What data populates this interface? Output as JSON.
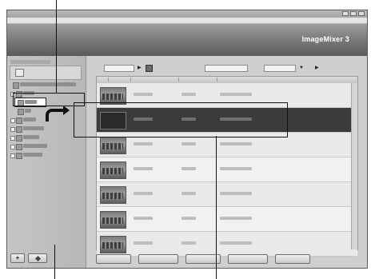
{
  "window": {
    "title": "",
    "menu": [
      "",
      "",
      "",
      "",
      "",
      ""
    ]
  },
  "header": {
    "logo": "ImageMixer 3"
  },
  "sidebar": {
    "heading": "",
    "tree": [
      {
        "label": ""
      },
      {
        "label": ""
      },
      {
        "label": ""
      },
      {
        "label": ""
      },
      {
        "label": ""
      },
      {
        "label": ""
      },
      {
        "label": ""
      },
      {
        "label": ""
      },
      {
        "label": ""
      }
    ],
    "buttons": [
      "",
      ""
    ]
  },
  "toolbar": {
    "labels": [
      "",
      "",
      "",
      ""
    ],
    "fields": [
      "",
      "",
      ""
    ]
  },
  "list": {
    "columns": [
      "",
      "",
      "",
      ""
    ],
    "rows": [
      {
        "c1": "",
        "c2": "",
        "c3": ""
      },
      {
        "c1": "",
        "c2": "",
        "c3": ""
      },
      {
        "c1": "",
        "c2": "",
        "c3": ""
      },
      {
        "c1": "",
        "c2": "",
        "c3": ""
      },
      {
        "c1": "",
        "c2": "",
        "c3": ""
      },
      {
        "c1": "",
        "c2": "",
        "c3": ""
      },
      {
        "c1": "",
        "c2": "",
        "c3": ""
      }
    ],
    "selected_row": 1
  },
  "bottom_buttons": [
    "",
    "",
    "",
    "",
    ""
  ],
  "colors": {
    "selection": "#3b3b3b",
    "header_dark": "#5a5a5a",
    "callout": "#111111"
  }
}
